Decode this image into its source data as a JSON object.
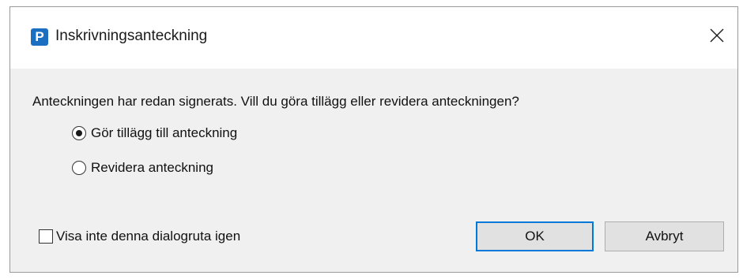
{
  "window": {
    "title": "Inskrivningsanteckning",
    "icon": "app-logo-p-icon",
    "icon_letter": "P",
    "accent_color": "#1b6fc1"
  },
  "dialog": {
    "question": "Anteckningen har redan signerats. Vill du göra tillägg eller revidera anteckningen?",
    "options": [
      {
        "label": "Gör tillägg till anteckning",
        "checked": true
      },
      {
        "label": "Revidera anteckning",
        "checked": false
      }
    ],
    "dont_show_again": {
      "label": "Visa inte denna dialogruta igen",
      "checked": false
    },
    "ok_label": "OK",
    "cancel_label": "Avbryt",
    "default_button_color": "#0078d7"
  }
}
